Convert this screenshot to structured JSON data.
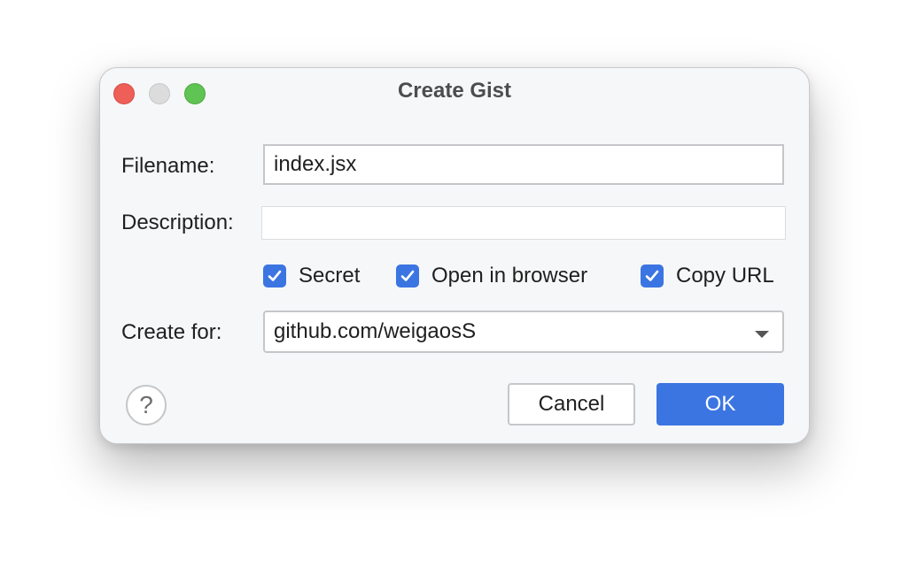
{
  "dialog": {
    "title": "Create Gist",
    "window_controls": [
      "close",
      "minimize",
      "maximize"
    ]
  },
  "form": {
    "filename_label": "Filename:",
    "filename_value": "index.jsx",
    "description_label": "Description:",
    "description_value": "",
    "options": [
      {
        "label": "Secret",
        "checked": true
      },
      {
        "label": "Open in browser",
        "checked": true
      },
      {
        "label": "Copy URL",
        "checked": true
      }
    ],
    "create_for_label": "Create for:",
    "create_for_value": "github.com/weigaosS"
  },
  "footer": {
    "help_symbol": "?",
    "cancel_label": "Cancel",
    "ok_label": "OK"
  },
  "colors": {
    "accent": "#3b75e2",
    "close": "#ee5f57",
    "minimize": "#dcdcdc",
    "maximize": "#5fc453"
  }
}
